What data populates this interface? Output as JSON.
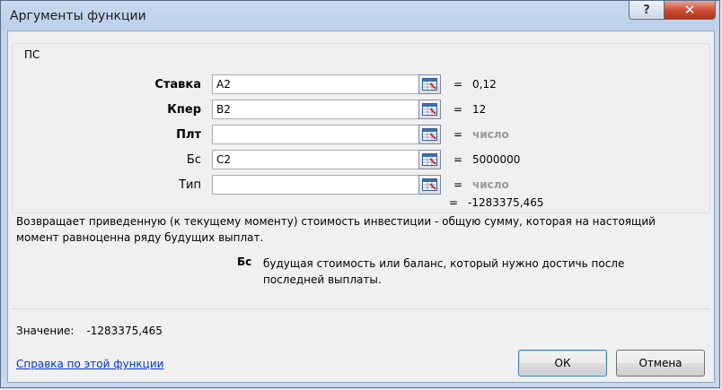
{
  "window": {
    "title": "Аргументы функции",
    "help_glyph": "?",
    "close_glyph": "✕"
  },
  "function": {
    "name": "ПС",
    "arguments": [
      {
        "label": "Ставка",
        "bold": true,
        "value": "A2",
        "result": "0,12",
        "result_gray": false
      },
      {
        "label": "Кпер",
        "bold": true,
        "value": "B2",
        "result": "12",
        "result_gray": false
      },
      {
        "label": "Плт",
        "bold": true,
        "value": "",
        "result": "число",
        "result_gray": true
      },
      {
        "label": "Бс",
        "bold": false,
        "value": "C2",
        "result": "5000000",
        "result_gray": false
      },
      {
        "label": "Тип",
        "bold": false,
        "value": "",
        "result": "число",
        "result_gray": true
      }
    ],
    "equals_sign": "=",
    "result": "-1283375,465",
    "description": "Возвращает приведенную (к текущему моменту) стоимость инвестиции - общую сумму, которая на настоящий момент равноценна ряду будущих выплат.",
    "current_arg_name": "Бс",
    "current_arg_description": "будущая стоимость или баланс, который нужно достичь после последней выплаты."
  },
  "footer": {
    "value_label": "Значение:",
    "value": "-1283375,465",
    "help_link": "Справка по этой функции",
    "ok_label": "ОК",
    "cancel_label": "Отмена"
  },
  "icons": {
    "ref_button": "range-select-icon"
  }
}
